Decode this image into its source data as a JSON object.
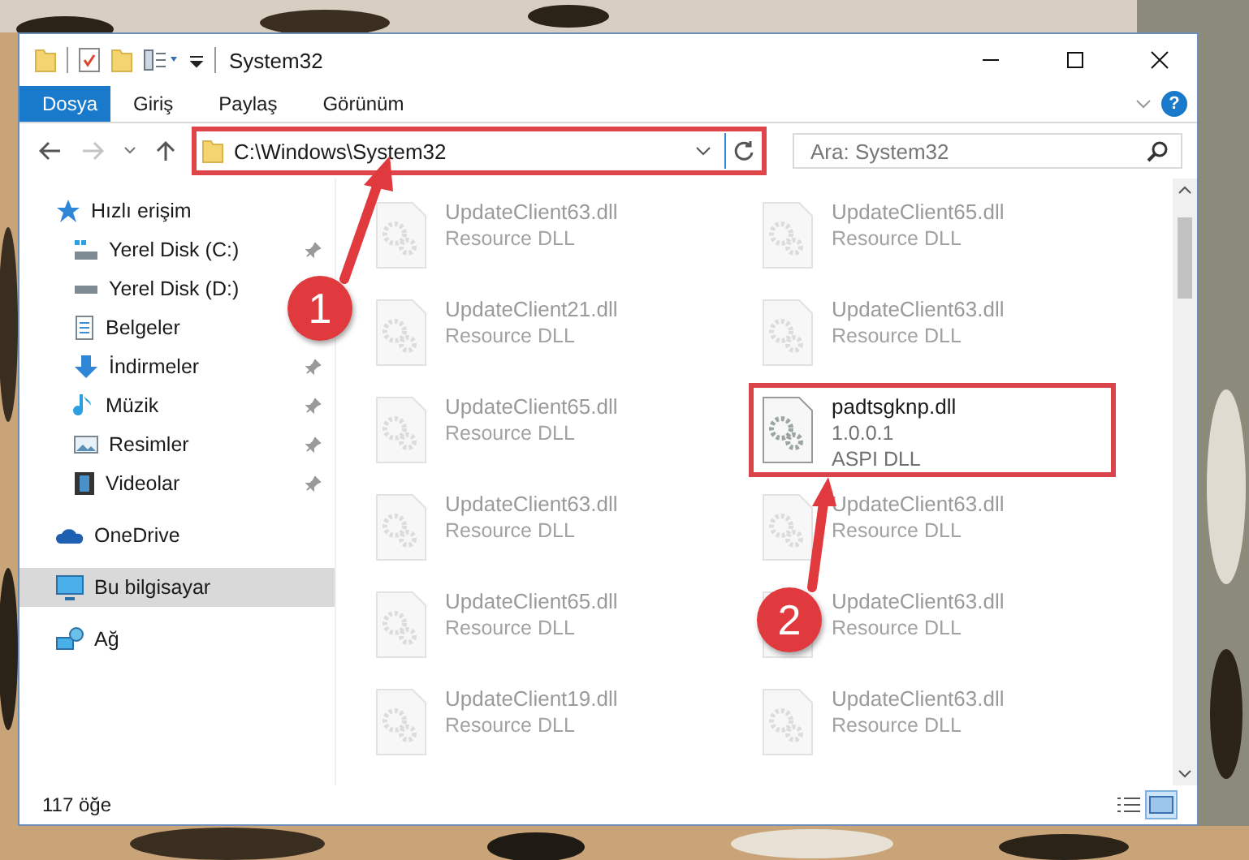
{
  "window": {
    "title": "System32"
  },
  "ribbon": {
    "tabs": [
      {
        "label": "Dosya",
        "kind": "file"
      },
      {
        "label": "Giriş",
        "kind": "tab"
      },
      {
        "label": "Paylaş",
        "kind": "tab"
      },
      {
        "label": "Görünüm",
        "kind": "tab"
      }
    ],
    "help": "?"
  },
  "address": {
    "path": "C:\\Windows\\System32",
    "highlighted": true
  },
  "search": {
    "placeholder": "Ara: System32"
  },
  "sidebar": {
    "items": [
      {
        "label": "Hızlı erişim",
        "selected": false,
        "children": [
          {
            "label": "Yerel Disk (C:)",
            "pinned": true,
            "selected": false
          },
          {
            "label": "Yerel Disk (D:)",
            "pinned": false,
            "selected": false
          },
          {
            "label": "Belgeler",
            "pinned": false,
            "selected": false
          },
          {
            "label": "İndirmeler",
            "pinned": true,
            "selected": false
          },
          {
            "label": "Müzik",
            "pinned": true,
            "selected": false
          },
          {
            "label": "Resimler",
            "pinned": true,
            "selected": false
          },
          {
            "label": "Videolar",
            "pinned": true,
            "selected": false
          }
        ]
      },
      {
        "label": "OneDrive",
        "selected": false
      },
      {
        "label": "Bu bilgisayar",
        "selected": true
      },
      {
        "label": "Ağ",
        "selected": false
      }
    ]
  },
  "files": [
    {
      "name": "UpdateClient63.dll",
      "lines": [
        "Resource DLL"
      ],
      "faded": true,
      "highlighted": false
    },
    {
      "name": "UpdateClient65.dll",
      "lines": [
        "Resource DLL"
      ],
      "faded": true,
      "highlighted": false
    },
    {
      "name": "UpdateClient21.dll",
      "lines": [
        "Resource DLL"
      ],
      "faded": true,
      "highlighted": false
    },
    {
      "name": "UpdateClient63.dll",
      "lines": [
        "Resource DLL"
      ],
      "faded": true,
      "highlighted": false
    },
    {
      "name": "UpdateClient65.dll",
      "lines": [
        "Resource DLL"
      ],
      "faded": true,
      "highlighted": false
    },
    {
      "name": "padtsgknp.dll",
      "lines": [
        "1.0.0.1",
        "ASPI DLL"
      ],
      "faded": false,
      "highlighted": true
    },
    {
      "name": "UpdateClient63.dll",
      "lines": [
        "Resource DLL"
      ],
      "faded": true,
      "highlighted": false
    },
    {
      "name": "UpdateClient63.dll",
      "lines": [
        "Resource DLL"
      ],
      "faded": true,
      "highlighted": false
    },
    {
      "name": "UpdateClient65.dll",
      "lines": [
        "Resource DLL"
      ],
      "faded": true,
      "highlighted": false
    },
    {
      "name": "UpdateClient63.dll",
      "lines": [
        "Resource DLL"
      ],
      "faded": true,
      "highlighted": false
    },
    {
      "name": "UpdateClient19.dll",
      "lines": [
        "Resource DLL"
      ],
      "faded": true,
      "highlighted": false
    },
    {
      "name": "UpdateClient63.dll",
      "lines": [
        "Resource DLL"
      ],
      "faded": true,
      "highlighted": false
    }
  ],
  "annotations": [
    {
      "number": "1"
    },
    {
      "number": "2"
    }
  ],
  "status_bar": {
    "count": "117 öğe",
    "views": [
      {
        "selected": false
      },
      {
        "selected": true
      }
    ]
  }
}
